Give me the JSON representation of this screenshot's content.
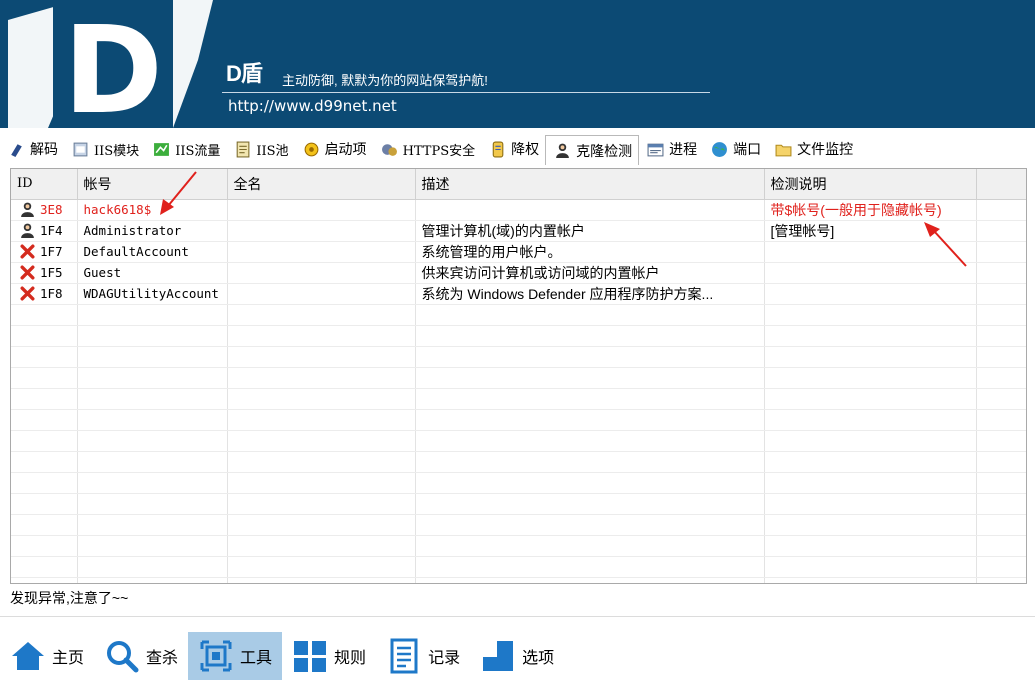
{
  "header": {
    "logo_letter": "D",
    "brand": "D盾",
    "slogan": "主动防御, 默默为你的网站保驾护航!",
    "url": "http://www.d99net.net"
  },
  "tabs": [
    {
      "label": "解码",
      "icon": "decode-icon"
    },
    {
      "label": "IIS模块",
      "icon": "module-icon"
    },
    {
      "label": "IIS流量",
      "icon": "traffic-icon"
    },
    {
      "label": "IIS池",
      "icon": "pool-icon"
    },
    {
      "label": "启动项",
      "icon": "startup-icon"
    },
    {
      "label": "HTTPS安全",
      "icon": "https-icon"
    },
    {
      "label": "降权",
      "icon": "downgrade-icon"
    },
    {
      "label": "克隆检测",
      "icon": "clone-icon",
      "active": true
    },
    {
      "label": "进程",
      "icon": "process-icon"
    },
    {
      "label": "端口",
      "icon": "port-icon"
    },
    {
      "label": "文件监控",
      "icon": "folder-icon"
    }
  ],
  "table": {
    "columns": [
      "ID",
      "帐号",
      "全名",
      "描述",
      "检测说明"
    ],
    "rows": [
      {
        "icon": "user-icon",
        "id": "3E8",
        "account": "hack6618$",
        "fullname": "",
        "description": "",
        "note": "带$帐号(一般用于隐藏帐号)",
        "alert": true
      },
      {
        "icon": "user-icon",
        "id": "1F4",
        "account": "Administrator",
        "fullname": "",
        "description": "管理计算机(域)的内置帐户",
        "note": "[管理帐号]",
        "alert": false
      },
      {
        "icon": "disabled-icon",
        "id": "1F7",
        "account": "DefaultAccount",
        "fullname": "",
        "description": "系统管理的用户帐户。",
        "note": "",
        "alert": false
      },
      {
        "icon": "disabled-icon",
        "id": "1F5",
        "account": "Guest",
        "fullname": "",
        "description": "供来宾访问计算机或访问域的内置帐户",
        "note": "",
        "alert": false
      },
      {
        "icon": "disabled-icon",
        "id": "1F8",
        "account": "WDAGUtilityAccount",
        "fullname": "",
        "description": "系统为 Windows Defender 应用程序防护方案...",
        "note": "",
        "alert": false
      }
    ]
  },
  "status": "发现异常,注意了~~",
  "bottom_nav": [
    {
      "label": "主页",
      "icon": "home-icon"
    },
    {
      "label": "查杀",
      "icon": "search-icon"
    },
    {
      "label": "工具",
      "icon": "tools-icon",
      "active": true
    },
    {
      "label": "规则",
      "icon": "rules-icon"
    },
    {
      "label": "记录",
      "icon": "log-icon"
    },
    {
      "label": "选项",
      "icon": "options-icon"
    }
  ],
  "colors": {
    "banner": "#0c4a74",
    "alert": "#e0211c",
    "active_nav": "#a9cbe6"
  }
}
